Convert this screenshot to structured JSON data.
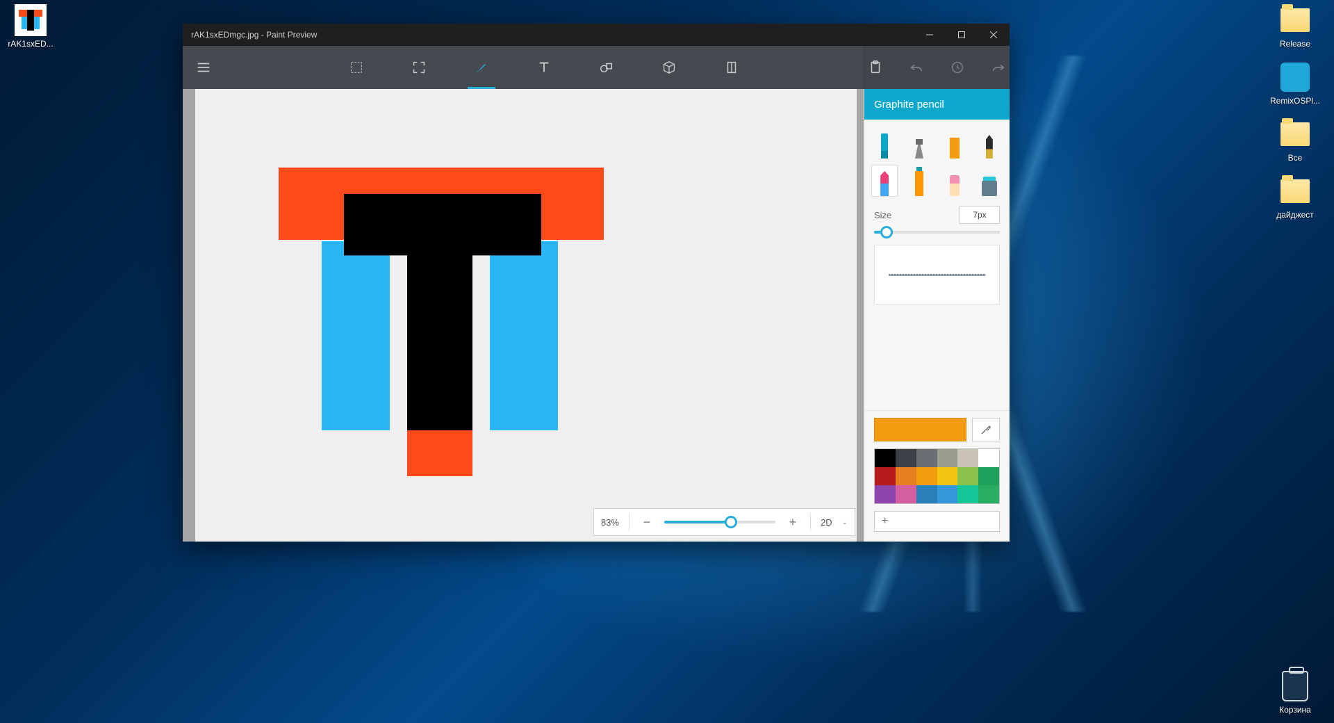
{
  "desktop": {
    "left_icons": [
      {
        "label": "rAK1sxED..."
      }
    ],
    "right_icons": [
      {
        "label": "Release"
      },
      {
        "label": "RemixOSPl..."
      },
      {
        "label": "Все"
      },
      {
        "label": "дайджест"
      }
    ],
    "recycle_label": "Корзина"
  },
  "window": {
    "title": "rAK1sxEDmgc.jpg - Paint Preview"
  },
  "toolbar": {
    "tools": [
      "select",
      "crop",
      "brush",
      "text",
      "shapes",
      "3d",
      "layers"
    ],
    "right": [
      "paste",
      "undo",
      "history",
      "redo"
    ]
  },
  "panel": {
    "header": "Graphite pencil",
    "size_label": "Size",
    "size_value": "7px"
  },
  "status": {
    "zoom": "83%",
    "mode": "2D"
  },
  "palette": {
    "current": "#f39c12",
    "colors": [
      "#000000",
      "#3a4045",
      "#6b6f73",
      "#9a9e8f",
      "#c9c3b6",
      "#ffffff",
      "#b71c1c",
      "#e67e22",
      "#f39c12",
      "#f1c40f",
      "#8bc34a",
      "#1fa05a",
      "#8e44ad",
      "#d35fa0",
      "#2980b9",
      "#3498db",
      "#16c79a",
      "#27ae60"
    ],
    "add_label": "+"
  }
}
